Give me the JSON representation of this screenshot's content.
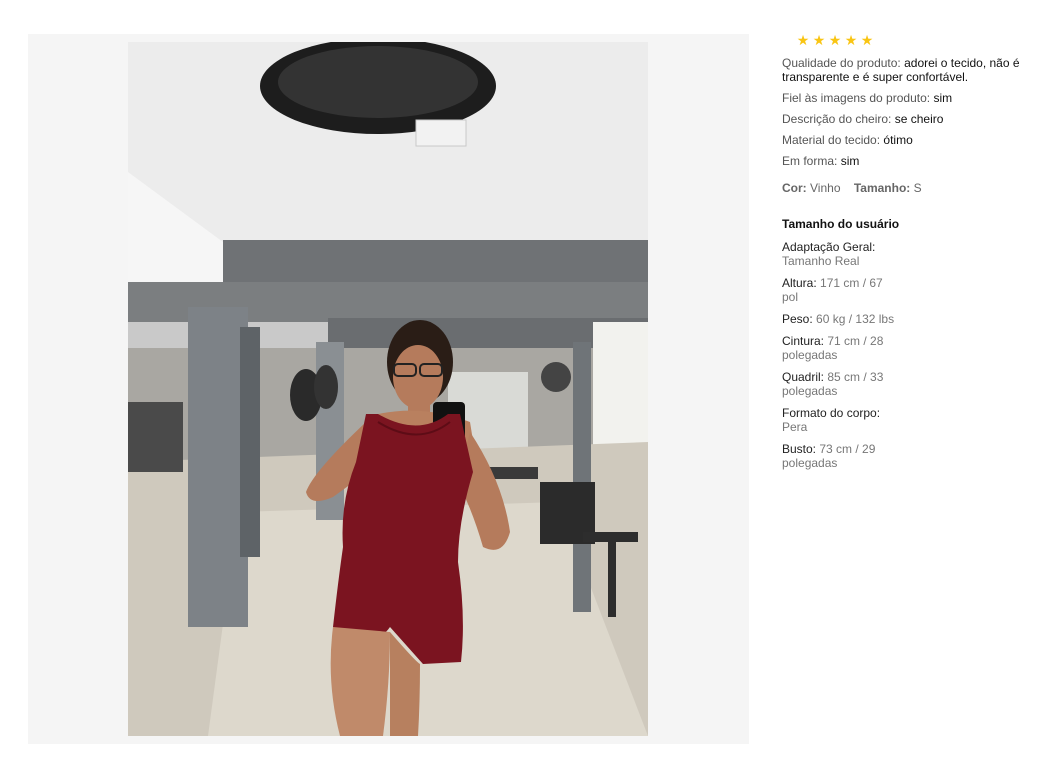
{
  "review": {
    "stars": [
      "★",
      "★",
      "★",
      "★",
      "★"
    ],
    "star_color": "#f9c513",
    "attributes": [
      {
        "label": "Qualidade do produto:",
        "value": "adorei o tecido, não é transparente e é super confortável."
      },
      {
        "label": "Fiel às imagens do produto:",
        "value": "sim"
      },
      {
        "label": "Descrição do cheiro:",
        "value": "se cheiro"
      },
      {
        "label": "Material do tecido:",
        "value": "ótimo"
      },
      {
        "label": "Em forma:",
        "value": "sim"
      }
    ],
    "color_label": "Cor:",
    "color_value": "Vinho",
    "size_label": "Tamanho:",
    "size_value": "S"
  },
  "user_size": {
    "title": "Tamanho do usuário",
    "fit_label": "Adaptação Geral:",
    "fit_value": "Tamanho Real",
    "height_label": "Altura:",
    "height_value": "171 cm / 67 pol",
    "weight_label": "Peso:",
    "weight_value": "60 kg / 132 lbs",
    "waist_label": "Cintura:",
    "waist_value": "71 cm / 28 polegadas",
    "hips_label": "Quadril:",
    "hips_value": "85 cm / 33 polegadas",
    "body_label": "Formato do corpo:",
    "body_value": "Pera",
    "bust_label": "Busto:",
    "bust_value": "73 cm / 29 polegadas"
  }
}
